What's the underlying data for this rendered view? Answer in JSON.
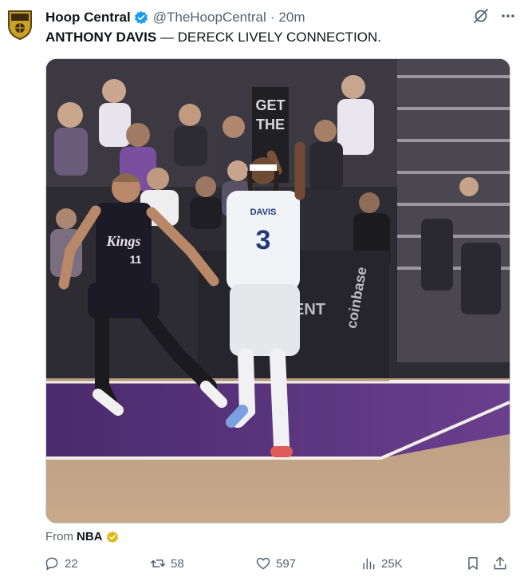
{
  "tweet": {
    "author_name": "Hoop Central",
    "handle": "@TheHoopCentral",
    "separator": "·",
    "time": "20m",
    "text_bold": "ANTHONY DAVIS",
    "text_rest": " — DERECK LIVELY CONNECTION."
  },
  "media": {
    "arena_sign": [
      "GET",
      "THE"
    ],
    "home_jersey_text": "Kings",
    "home_jersey_number": "11",
    "away_jersey_name": "DAVIS",
    "away_jersey_number": "3",
    "court_ad": "coinbase",
    "court_ad2": "ENT"
  },
  "source": {
    "prefix": "From",
    "name": "NBA"
  },
  "actions": {
    "replies": "22",
    "reposts": "58",
    "likes": "597",
    "views": "25K"
  },
  "colors": {
    "text": "#0f1419",
    "muted": "#536471",
    "verified_blue": "#1d9bf0",
    "verified_gold": "#e2b719",
    "kings_purple": "#5a2d81"
  },
  "icons": {
    "verified": "verified-badge-icon",
    "grok": "grok-icon",
    "more": "more-icon",
    "reply": "reply-icon",
    "repost": "repost-icon",
    "like": "heart-icon",
    "views": "views-icon",
    "bookmark": "bookmark-icon",
    "share": "share-icon"
  }
}
